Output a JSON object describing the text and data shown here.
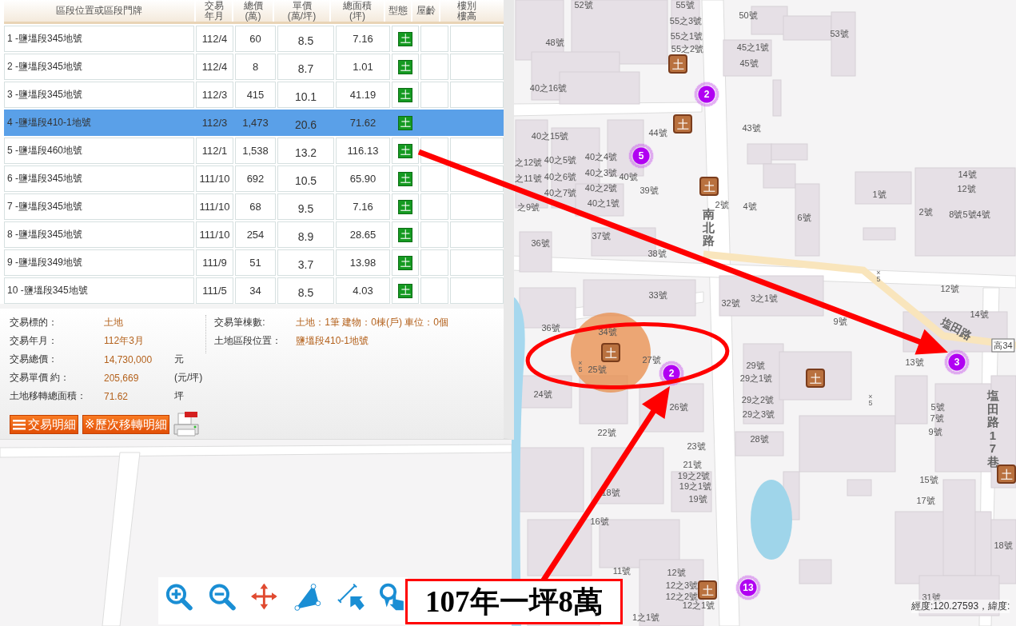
{
  "table": {
    "columns": [
      [
        "區段位置或區段門牌"
      ],
      [
        "交易",
        "年月"
      ],
      [
        "總價",
        "(萬)"
      ],
      [
        "單價",
        "(萬/坪)"
      ],
      [
        "總面積",
        "(坪)"
      ],
      [
        "型態"
      ],
      [
        "屋齡"
      ],
      [
        "樓別",
        "樓高"
      ]
    ],
    "rows": [
      {
        "address": "1  -鹽塭段345地號",
        "date": "112/4",
        "total": "60",
        "unit_price": "8.5",
        "area": "7.16",
        "type": "土",
        "selected": false
      },
      {
        "address": "2  -鹽塭段345地號",
        "date": "112/4",
        "total": "8",
        "unit_price": "8.7",
        "area": "1.01",
        "type": "土",
        "selected": false
      },
      {
        "address": "3  -鹽塭段345地號",
        "date": "112/3",
        "total": "415",
        "unit_price": "10.1",
        "area": "41.19",
        "type": "土",
        "selected": false
      },
      {
        "address": "4  -鹽塭段410-1地號",
        "date": "112/3",
        "total": "1,473",
        "unit_price": "20.6",
        "area": "71.62",
        "type": "土",
        "selected": true
      },
      {
        "address": "5  -鹽塭段460地號",
        "date": "112/1",
        "total": "1,538",
        "unit_price": "13.2",
        "area": "116.13",
        "type": "土",
        "selected": false
      },
      {
        "address": "6  -鹽塭段345地號",
        "date": "111/10",
        "total": "692",
        "unit_price": "10.5",
        "area": "65.90",
        "type": "土",
        "selected": false
      },
      {
        "address": "7  -鹽塭段345地號",
        "date": "111/10",
        "total": "68",
        "unit_price": "9.5",
        "area": "7.16",
        "type": "土",
        "selected": false
      },
      {
        "address": "8  -鹽塭段345地號",
        "date": "111/10",
        "total": "254",
        "unit_price": "8.9",
        "area": "28.65",
        "type": "土",
        "selected": false
      },
      {
        "address": "9  -鹽塭段349地號",
        "date": "111/9",
        "total": "51",
        "unit_price": "3.7",
        "area": "13.98",
        "type": "土",
        "selected": false
      },
      {
        "address": "10  -鹽塭段345地號",
        "date": "111/5",
        "total": "34",
        "unit_price": "8.5",
        "area": "4.03",
        "type": "土",
        "selected": false
      }
    ]
  },
  "details": {
    "left": [
      {
        "label": "交易標的：",
        "value": "土地"
      },
      {
        "label": "交易年月：",
        "value": "112年3月"
      },
      {
        "label": "交易總價：",
        "value": "14,730,000",
        "unit": "元"
      },
      {
        "label": "交易單價 約：",
        "value": "205,669",
        "unit": "(元/坪)"
      },
      {
        "label": "土地移轉總面積：",
        "value": "71.62",
        "unit": "坪"
      }
    ],
    "right": [
      {
        "label": "交易筆棟數:",
        "value": "土地：1筆 建物：0棟(戶) 車位：0個"
      },
      {
        "label": "土地區段位置：",
        "value": "鹽塭段410-1地號"
      }
    ],
    "buttons": [
      {
        "label": "交易明細",
        "kind": "list"
      },
      {
        "label": "※歷次移轉明細",
        "kind": "plain"
      }
    ]
  },
  "map": {
    "labels": [
      "52號",
      "55號",
      "55之3號",
      "55之1號",
      "55之2號",
      "50號",
      "53號",
      "48號",
      "45之1號",
      "45號",
      "40之16號",
      "40之15號",
      "44號",
      "43號",
      "之12號",
      "40之5號",
      "40之4號",
      "之11號",
      "40之6號",
      "40之3號",
      "40號",
      "40之7號",
      "40之2號",
      "39號",
      "之9號",
      "40之1號",
      "2號",
      "4號",
      "6號",
      "1號",
      "14號",
      "12號",
      "2號",
      "8號5號4號",
      "36號",
      "37號",
      "38號",
      "33號",
      "3之1號",
      "32號",
      "9號",
      "12號",
      "14號",
      "36號",
      "34號",
      "27號",
      "25號",
      "24號",
      "29號",
      "29之1號",
      "29之2號",
      "29之3號",
      "28號",
      "13號",
      "26號",
      "5號",
      "7號",
      "9號",
      "22號",
      "23號",
      "21號",
      "19之2號",
      "19之1號",
      "19號",
      "18號",
      "15號",
      "17號",
      "16號",
      "18號",
      "12號",
      "12之3號",
      "12之2號",
      "12之1號",
      "11號",
      "31號",
      "1之1號"
    ],
    "roads": [
      {
        "text": "南北路",
        "kind": "vertical"
      },
      {
        "text": "塩田路",
        "kind": "rotated"
      },
      {
        "text": "塩田路17巷",
        "kind": "vertical"
      },
      {
        "text": "高34",
        "kind": "shield"
      }
    ],
    "elevation_marks": [
      {
        "symbol": "×",
        "value": "5"
      },
      {
        "symbol": "×",
        "value": "5"
      },
      {
        "symbol": "×",
        "value": "5"
      }
    ],
    "land_markers": [
      "土",
      "土",
      "土",
      "土",
      "土",
      "土",
      "土"
    ],
    "cluster_markers": [
      "2",
      "5",
      "2",
      "3",
      "13"
    ],
    "coordinate_readout": "經度:120.27593，緯度:"
  },
  "toolbar": [
    {
      "kind": "zoom-in"
    },
    {
      "kind": "zoom-out"
    },
    {
      "kind": "pan"
    },
    {
      "kind": "polygon"
    },
    {
      "kind": "measure"
    },
    {
      "kind": "select"
    }
  ],
  "annotation": {
    "callout": "107年一坪8萬"
  }
}
